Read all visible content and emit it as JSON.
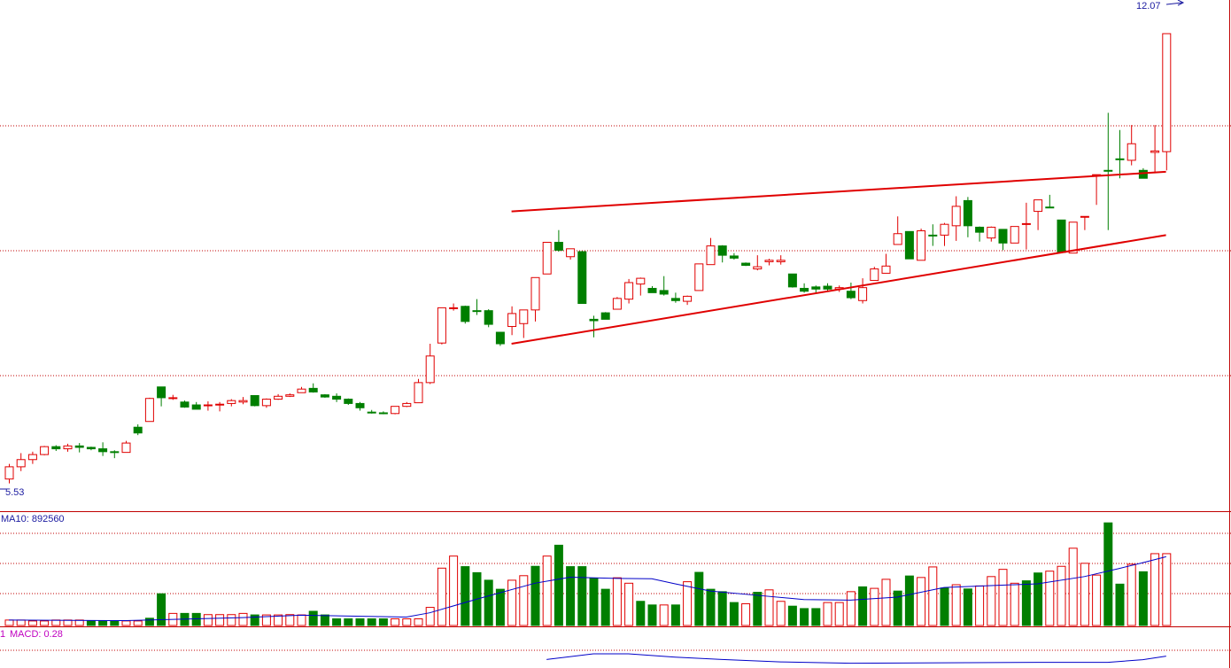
{
  "colors": {
    "up": "#e00000",
    "down": "#007f00",
    "grid": "#c00000",
    "trend": "#e00000",
    "ma": "#0000c8",
    "label": "#1a1aa0",
    "macd_label": "#c000c0",
    "macd_line": "#0000c8"
  },
  "chart_data": {
    "type": "candlestick",
    "price_labels": {
      "high": "12.07",
      "low": "5.53"
    },
    "price_range": [
      5.5,
      12.1
    ],
    "candles": [
      [
        5.59,
        5.76,
        5.53,
        5.8,
        "up"
      ],
      [
        5.76,
        5.86,
        5.7,
        5.95,
        "up"
      ],
      [
        5.86,
        5.93,
        5.8,
        5.97,
        "up"
      ],
      [
        5.93,
        6.04,
        5.92,
        6.05,
        "up"
      ],
      [
        6.04,
        6.01,
        5.98,
        6.06,
        "down"
      ],
      [
        6.01,
        6.05,
        5.97,
        6.08,
        "up"
      ],
      [
        6.05,
        6.03,
        5.96,
        6.09,
        "down"
      ],
      [
        6.03,
        6.01,
        5.99,
        6.04,
        "down"
      ],
      [
        6.01,
        5.97,
        5.91,
        6.1,
        "down"
      ],
      [
        5.97,
        5.96,
        5.88,
        5.99,
        "down"
      ],
      [
        5.96,
        6.09,
        5.96,
        6.12,
        "up"
      ],
      [
        6.31,
        6.23,
        6.2,
        6.35,
        "down"
      ],
      [
        6.39,
        6.71,
        6.39,
        6.72,
        "up"
      ],
      [
        6.87,
        6.72,
        6.6,
        6.87,
        "down"
      ],
      [
        6.72,
        6.72,
        6.69,
        6.76,
        "up"
      ],
      [
        6.66,
        6.59,
        6.58,
        6.68,
        "down"
      ],
      [
        6.62,
        6.56,
        6.56,
        6.66,
        "down"
      ],
      [
        6.61,
        6.62,
        6.54,
        6.67,
        "up"
      ],
      [
        6.62,
        6.63,
        6.53,
        6.66,
        "up"
      ],
      [
        6.64,
        6.68,
        6.6,
        6.7,
        "up"
      ],
      [
        6.66,
        6.68,
        6.63,
        6.73,
        "up"
      ],
      [
        6.75,
        6.61,
        6.6,
        6.75,
        "down"
      ],
      [
        6.61,
        6.7,
        6.58,
        6.71,
        "up"
      ],
      [
        6.7,
        6.74,
        6.69,
        6.77,
        "up"
      ],
      [
        6.74,
        6.76,
        6.73,
        6.78,
        "up"
      ],
      [
        6.79,
        6.84,
        6.79,
        6.87,
        "up"
      ],
      [
        6.85,
        6.8,
        6.79,
        6.92,
        "down"
      ],
      [
        6.76,
        6.73,
        6.72,
        6.77,
        "down"
      ],
      [
        6.74,
        6.7,
        6.66,
        6.78,
        "down"
      ],
      [
        6.7,
        6.64,
        6.62,
        6.71,
        "down"
      ],
      [
        6.64,
        6.58,
        6.54,
        6.66,
        "down"
      ],
      [
        6.52,
        6.51,
        6.5,
        6.55,
        "down"
      ],
      [
        6.51,
        6.5,
        6.49,
        6.53,
        "down"
      ],
      [
        6.5,
        6.6,
        6.49,
        6.6,
        "up"
      ],
      [
        6.6,
        6.64,
        6.59,
        6.66,
        "up"
      ],
      [
        6.65,
        6.93,
        6.65,
        6.98,
        "up"
      ],
      [
        6.93,
        7.3,
        6.91,
        7.47,
        "up"
      ],
      [
        7.48,
        7.97,
        7.46,
        7.97,
        "up"
      ],
      [
        7.97,
        7.97,
        7.93,
        8.03,
        "up"
      ],
      [
        7.99,
        7.78,
        7.75,
        8.0,
        "down"
      ],
      [
        7.93,
        7.92,
        7.87,
        8.09,
        "down"
      ],
      [
        7.93,
        7.74,
        7.7,
        7.95,
        "down"
      ],
      [
        7.63,
        7.47,
        7.44,
        7.63,
        "down"
      ],
      [
        7.71,
        7.89,
        7.59,
        7.99,
        "up"
      ],
      [
        7.75,
        7.94,
        7.55,
        7.94,
        "up"
      ],
      [
        7.94,
        8.39,
        7.78,
        8.39,
        "up"
      ],
      [
        8.44,
        8.88,
        8.44,
        8.88,
        "up"
      ],
      [
        8.88,
        8.77,
        8.75,
        9.05,
        "down"
      ],
      [
        8.68,
        8.79,
        8.64,
        8.79,
        "up"
      ],
      [
        8.75,
        8.03,
        8.03,
        8.76,
        "down"
      ],
      [
        7.79,
        7.81,
        7.56,
        7.86,
        "down"
      ],
      [
        7.9,
        7.81,
        7.81,
        7.91,
        "down"
      ],
      [
        7.95,
        8.1,
        7.95,
        8.12,
        "up"
      ],
      [
        8.09,
        8.32,
        8.03,
        8.37,
        "up"
      ],
      [
        8.3,
        8.38,
        8.14,
        8.39,
        "up"
      ],
      [
        8.18,
        8.24,
        8.18,
        8.27,
        "down"
      ],
      [
        8.16,
        8.21,
        8.14,
        8.41,
        "down"
      ],
      [
        8.1,
        8.07,
        8.04,
        8.18,
        "down"
      ],
      [
        8.06,
        8.13,
        8.01,
        8.14,
        "up"
      ],
      [
        8.21,
        8.58,
        8.21,
        8.58,
        "up"
      ],
      [
        8.57,
        8.83,
        8.57,
        8.94,
        "up"
      ],
      [
        8.83,
        8.7,
        8.6,
        8.84,
        "down"
      ],
      [
        8.69,
        8.66,
        8.64,
        8.73,
        "down"
      ],
      [
        8.59,
        8.56,
        8.55,
        8.6,
        "down"
      ],
      [
        8.51,
        8.54,
        8.49,
        8.7,
        "up"
      ],
      [
        8.63,
        8.61,
        8.56,
        8.65,
        "up"
      ],
      [
        8.61,
        8.63,
        8.57,
        8.7,
        "up"
      ],
      [
        8.44,
        8.26,
        8.25,
        8.44,
        "down"
      ],
      [
        8.24,
        8.2,
        8.18,
        8.31,
        "down"
      ],
      [
        8.23,
        8.26,
        8.17,
        8.28,
        "down"
      ],
      [
        8.27,
        8.23,
        8.2,
        8.31,
        "down"
      ],
      [
        8.23,
        8.25,
        8.19,
        8.28,
        "up"
      ],
      [
        8.2,
        8.11,
        8.09,
        8.32,
        "down"
      ],
      [
        8.07,
        8.25,
        8.03,
        8.38,
        "up"
      ],
      [
        8.35,
        8.51,
        8.35,
        8.54,
        "up"
      ],
      [
        8.45,
        8.55,
        8.55,
        8.72,
        "up"
      ],
      [
        8.85,
        9.0,
        8.85,
        9.24,
        "up"
      ],
      [
        9.03,
        8.65,
        8.65,
        9.03,
        "down"
      ],
      [
        8.63,
        9.04,
        8.63,
        9.07,
        "up"
      ],
      [
        8.98,
        8.98,
        8.83,
        9.13,
        "down"
      ],
      [
        8.98,
        9.13,
        8.83,
        9.15,
        "up"
      ],
      [
        9.38,
        9.11,
        8.9,
        9.52,
        "up"
      ],
      [
        9.46,
        9.11,
        8.95,
        9.51,
        "down"
      ],
      [
        9.09,
        9.02,
        8.89,
        9.1,
        "down"
      ],
      [
        8.94,
        9.09,
        8.89,
        9.1,
        "up"
      ],
      [
        9.06,
        8.87,
        8.77,
        9.06,
        "down"
      ],
      [
        8.87,
        9.1,
        8.87,
        9.1,
        "up"
      ],
      [
        9.14,
        9.14,
        8.78,
        9.43,
        "up"
      ],
      [
        9.31,
        9.47,
        9.05,
        9.47,
        "up"
      ],
      [
        9.37,
        9.37,
        9.37,
        9.54,
        "down"
      ],
      [
        9.19,
        8.74,
        8.74,
        9.19,
        "down"
      ],
      [
        8.73,
        9.16,
        8.73,
        9.16,
        "up"
      ],
      [
        9.24,
        9.24,
        9.05,
        9.24,
        "up"
      ],
      [
        9.82,
        9.82,
        9.4,
        9.82,
        "up"
      ],
      [
        9.88,
        9.88,
        9.05,
        10.68,
        "down"
      ],
      [
        10.04,
        10.04,
        9.77,
        10.44,
        "down"
      ],
      [
        10.02,
        10.25,
        9.95,
        10.51,
        "up"
      ],
      [
        9.77,
        9.88,
        9.88,
        9.91,
        "down"
      ],
      [
        10.13,
        10.15,
        9.84,
        10.51,
        "up"
      ],
      [
        10.14,
        11.78,
        9.88,
        11.78,
        "up"
      ]
    ],
    "trend_lines": [
      {
        "from": [
          43,
          9.31
        ],
        "to": [
          98,
          9.86
        ]
      },
      {
        "from": [
          43,
          7.47
        ],
        "to": [
          98,
          8.98
        ]
      }
    ],
    "volume_label": "MA10: 892560",
    "volume_range": [
      0,
      3200000
    ],
    "volume": [
      [
        180000,
        "up"
      ],
      [
        180000,
        "up"
      ],
      [
        150000,
        "up"
      ],
      [
        150000,
        "up"
      ],
      [
        180000,
        "up"
      ],
      [
        180000,
        "up"
      ],
      [
        180000,
        "up"
      ],
      [
        150000,
        "down"
      ],
      [
        150000,
        "down"
      ],
      [
        150000,
        "down"
      ],
      [
        150000,
        "up"
      ],
      [
        150000,
        "up"
      ],
      [
        240000,
        "down"
      ],
      [
        1050000,
        "down"
      ],
      [
        400000,
        "up"
      ],
      [
        400000,
        "down"
      ],
      [
        400000,
        "down"
      ],
      [
        360000,
        "up"
      ],
      [
        360000,
        "up"
      ],
      [
        360000,
        "up"
      ],
      [
        400000,
        "up"
      ],
      [
        350000,
        "down"
      ],
      [
        350000,
        "up"
      ],
      [
        350000,
        "up"
      ],
      [
        360000,
        "up"
      ],
      [
        350000,
        "up"
      ],
      [
        470000,
        "down"
      ],
      [
        350000,
        "down"
      ],
      [
        220000,
        "down"
      ],
      [
        220000,
        "down"
      ],
      [
        220000,
        "down"
      ],
      [
        220000,
        "down"
      ],
      [
        220000,
        "down"
      ],
      [
        220000,
        "up"
      ],
      [
        220000,
        "up"
      ],
      [
        220000,
        "up"
      ],
      [
        600000,
        "up"
      ],
      [
        1900000,
        "up"
      ],
      [
        2300000,
        "up"
      ],
      [
        1950000,
        "down"
      ],
      [
        1750000,
        "down"
      ],
      [
        1500000,
        "down"
      ],
      [
        1200000,
        "down"
      ],
      [
        1500000,
        "up"
      ],
      [
        1650000,
        "up"
      ],
      [
        1960000,
        "down"
      ],
      [
        2300000,
        "up"
      ],
      [
        2660000,
        "down"
      ],
      [
        1950000,
        "down"
      ],
      [
        1950000,
        "down"
      ],
      [
        1570000,
        "down"
      ],
      [
        1200000,
        "down"
      ],
      [
        1580000,
        "up"
      ],
      [
        1400000,
        "up"
      ],
      [
        800000,
        "down"
      ],
      [
        680000,
        "down"
      ],
      [
        680000,
        "up"
      ],
      [
        680000,
        "down"
      ],
      [
        1450000,
        "up"
      ],
      [
        1760000,
        "down"
      ],
      [
        1200000,
        "down"
      ],
      [
        1120000,
        "down"
      ],
      [
        760000,
        "down"
      ],
      [
        720000,
        "up"
      ],
      [
        1100000,
        "down"
      ],
      [
        1180000,
        "up"
      ],
      [
        800000,
        "up"
      ],
      [
        640000,
        "down"
      ],
      [
        560000,
        "down"
      ],
      [
        560000,
        "down"
      ],
      [
        760000,
        "up"
      ],
      [
        760000,
        "up"
      ],
      [
        1120000,
        "up"
      ],
      [
        1280000,
        "down"
      ],
      [
        1230000,
        "up"
      ],
      [
        1530000,
        "up"
      ],
      [
        1140000,
        "down"
      ],
      [
        1640000,
        "down"
      ],
      [
        1590000,
        "up"
      ],
      [
        1940000,
        "up"
      ],
      [
        1240000,
        "down"
      ],
      [
        1350000,
        "up"
      ],
      [
        1210000,
        "down"
      ],
      [
        1310000,
        "up"
      ],
      [
        1620000,
        "up"
      ],
      [
        1860000,
        "up"
      ],
      [
        1400000,
        "up"
      ],
      [
        1480000,
        "down"
      ],
      [
        1740000,
        "down"
      ],
      [
        1800000,
        "up"
      ],
      [
        1960000,
        "up"
      ],
      [
        2560000,
        "up"
      ],
      [
        2060000,
        "up"
      ],
      [
        1670000,
        "up"
      ],
      [
        3400000,
        "down"
      ],
      [
        1370000,
        "down"
      ],
      [
        2030000,
        "up"
      ],
      [
        1780000,
        "down"
      ],
      [
        2380000,
        "up"
      ],
      [
        2380000,
        "up"
      ]
    ],
    "volume_ma10": [
      [
        0,
        180000
      ],
      [
        10,
        160000
      ],
      [
        20,
        260000
      ],
      [
        25,
        340000
      ],
      [
        34,
        280000
      ],
      [
        36,
        420000
      ],
      [
        40,
        870000
      ],
      [
        45,
        1400000
      ],
      [
        48,
        1600000
      ],
      [
        52,
        1560000
      ],
      [
        55,
        1550000
      ],
      [
        57,
        1380000
      ],
      [
        60,
        1140000
      ],
      [
        64,
        1000000
      ],
      [
        68,
        860000
      ],
      [
        72,
        840000
      ],
      [
        76,
        940000
      ],
      [
        80,
        1260000
      ],
      [
        84,
        1320000
      ],
      [
        88,
        1380000
      ],
      [
        92,
        1620000
      ],
      [
        95,
        1890000
      ],
      [
        97,
        2080000
      ],
      [
        99,
        2280000
      ]
    ],
    "macd_label": "MACD: 0.28",
    "macd_line": [
      [
        46,
        0.06
      ],
      [
        50,
        0.3
      ],
      [
        53,
        0.3
      ],
      [
        57,
        0.16
      ],
      [
        61,
        0.06
      ],
      [
        66,
        -0.04
      ],
      [
        72,
        -0.1
      ],
      [
        80,
        -0.08
      ],
      [
        88,
        -0.06
      ],
      [
        94,
        -0.06
      ],
      [
        97,
        0.05
      ],
      [
        99,
        0.2
      ]
    ],
    "macd_range": [
      -0.3,
      0.9
    ]
  }
}
